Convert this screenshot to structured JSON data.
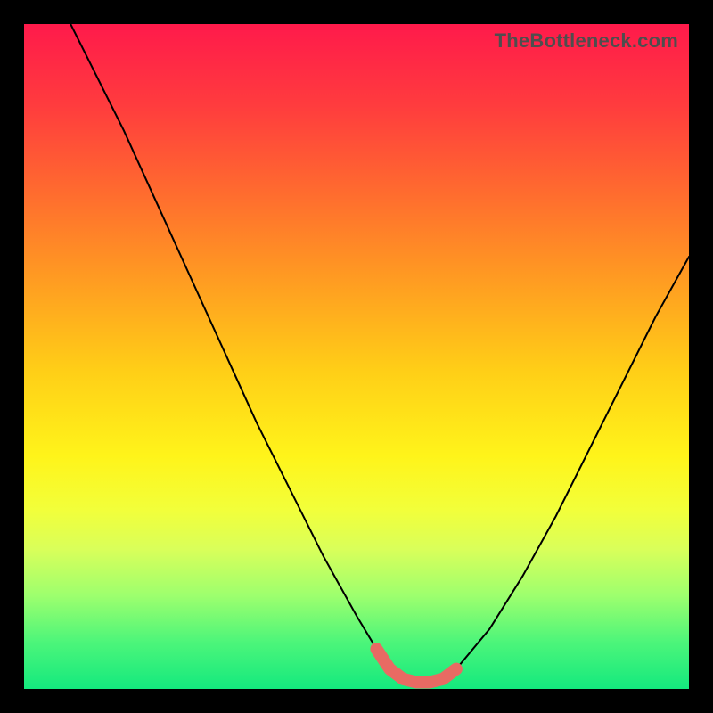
{
  "watermark": "TheBottleneck.com",
  "chart_data": {
    "type": "line",
    "title": "",
    "xlabel": "",
    "ylabel": "",
    "xlim": [
      0,
      100
    ],
    "ylim": [
      0,
      100
    ],
    "grid": false,
    "legend": false,
    "series": [
      {
        "name": "bottleneck-curve",
        "color": "#000000",
        "x": [
          7,
          10,
          15,
          20,
          25,
          30,
          35,
          40,
          45,
          50,
          53,
          55,
          57,
          59,
          61,
          63,
          65,
          70,
          75,
          80,
          85,
          90,
          95,
          100
        ],
        "values": [
          100,
          94,
          84,
          73,
          62,
          51,
          40,
          30,
          20,
          11,
          6,
          3,
          1.5,
          1,
          1,
          1.5,
          3,
          9,
          17,
          26,
          36,
          46,
          56,
          65
        ]
      },
      {
        "name": "optimal-range-marker",
        "color": "#e86a63",
        "x": [
          53,
          55,
          57,
          59,
          61,
          63,
          65
        ],
        "values": [
          6,
          3,
          1.5,
          1,
          1,
          1.5,
          3
        ]
      }
    ],
    "background_gradient": {
      "top": "#ff1a4b",
      "middle": "#ffe31a",
      "bottom": "#14e97e"
    }
  }
}
